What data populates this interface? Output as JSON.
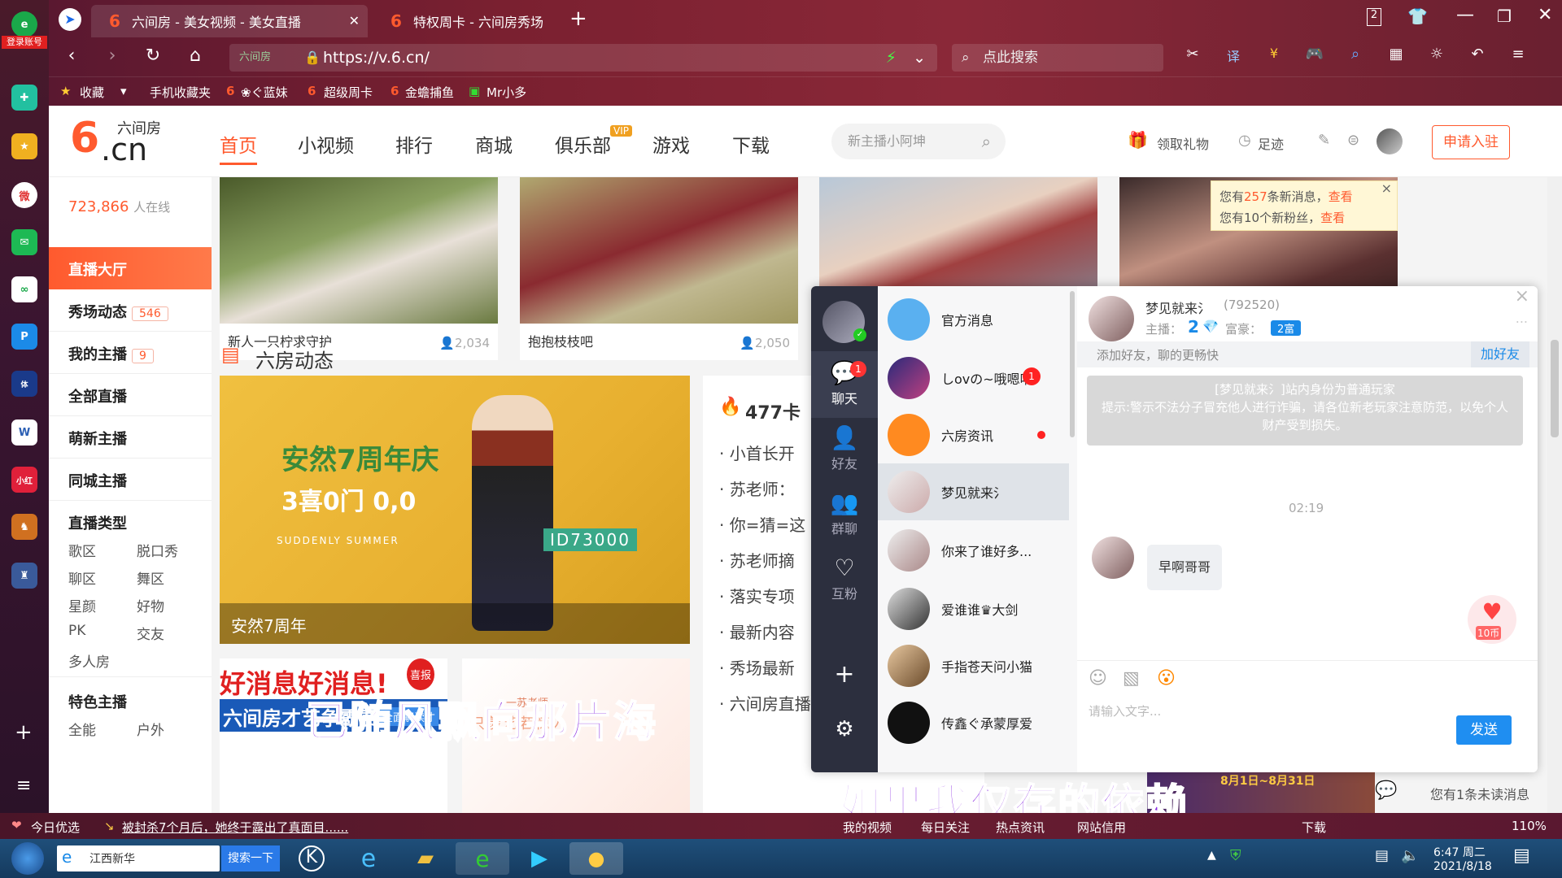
{
  "dock": {
    "login_label": "登录账号",
    "app_icons": [
      "browser-logo-icon",
      "plus-app-icon",
      "star-app-icon",
      "weibo-icon",
      "mail-icon",
      "cloud-icon",
      "p-app-icon",
      "sports-app-icon",
      "word-icon",
      "xiaohongshu-icon",
      "game-icon",
      "game2-icon"
    ],
    "add_label": "+",
    "menu_label": "≡"
  },
  "browser": {
    "tabs": [
      {
        "label": "六间房 - 美女视频 - 美女直播"
      },
      {
        "label": "特权周卡 - 六间房秀场"
      }
    ],
    "new_tab": "+",
    "url": "https://v.6.cn/",
    "url_site_tag": "六间房",
    "search_placeholder": "点此搜索",
    "bookmarks": [
      "收藏",
      "手机收藏夹",
      "❀ぐ蓝妹",
      "超级周卡",
      "金蟾捕鱼",
      "Mr小多"
    ],
    "window_count": "2"
  },
  "site": {
    "logo_text": "六间房",
    "logo_big": "6.cn",
    "nav": [
      "首页",
      "小视频",
      "排行",
      "商城",
      "俱乐部",
      "游戏",
      "下载"
    ],
    "vip_badge": "VIP",
    "search_placeholder": "新主播小阿坤",
    "gift_label": "领取礼物",
    "footprint_label": "足迹",
    "apply_label": "申请入驻"
  },
  "sidebar": {
    "online_count": "723,866",
    "online_suffix": "人在线",
    "items": [
      {
        "label": "直播大厅"
      },
      {
        "label": "秀场动态",
        "badge": "546"
      },
      {
        "label": "我的主播",
        "badge": "9"
      },
      {
        "label": "全部直播"
      },
      {
        "label": "萌新主播"
      },
      {
        "label": "同城主播"
      },
      {
        "label": "直播类型"
      }
    ],
    "types": [
      "歌区",
      "脱口秀",
      "聊区",
      "舞区",
      "星颜",
      "好物",
      "PK",
      "交友",
      "多人房"
    ],
    "special_label": "特色主播",
    "special_items": [
      "全能",
      "户外"
    ]
  },
  "cards": [
    {
      "title": "新人一只柠求守护",
      "count": "2,034"
    },
    {
      "title": "抱抱枝枝吧",
      "count": "2,050"
    }
  ],
  "notice": {
    "line1_a": "您有",
    "line1_n": "257",
    "line1_b": "条新消息，",
    "line1_link": "查看",
    "line2_a": "您有10个新粉丝，",
    "line2_link": "查看",
    "close": "×"
  },
  "dynamics": {
    "title": "六房动态",
    "banner_title": "安然7周年庆",
    "banner_sub": "3喜0门 0,0",
    "banner_en": "SUDDENLY SUMMER",
    "banner_id": "ID73000",
    "banner_caption": "安然7周年",
    "hot_count": "477",
    "hot_label": "卡",
    "news": [
      "小首长开",
      "苏老师：",
      "你=猜=这",
      "苏老师摘",
      "落实专项",
      "最新内容",
      "秀场最新",
      "六间房直播文"
    ],
    "promo1": "好消息好消息!",
    "promo1_tag": "喜报",
    "promo1_sub": "六间房才艺争霸赛",
    "promo1_btn": "全面解读才",
    "promo2": "只羡艺若惊人",
    "promo2_tag": "一苏老师一"
  },
  "chat": {
    "nav": [
      "聊天",
      "好友",
      "群聊",
      "互粉"
    ],
    "chat_badge": "1",
    "add": "+",
    "list": [
      {
        "name": "官方消息"
      },
      {
        "name": "しovの~哦嗯呐",
        "badge": "1"
      },
      {
        "name": "六房资讯"
      },
      {
        "name": "梦见就来氵"
      },
      {
        "name": "你来了谁好多..."
      },
      {
        "name": "爱谁谁♛大剑"
      },
      {
        "name": "手指苍天问小猫"
      },
      {
        "name": "传鑫ぐ承蒙厚爱"
      }
    ],
    "peer_name": "梦见就来氵",
    "peer_id": "(792520)",
    "anchor_label": "主播：",
    "anchor_level": "2",
    "rich_label": "富豪：",
    "rich_level": "2富",
    "add_friend_hint": "添加好友，聊的更畅快",
    "add_friend_btn": "加好友",
    "system_line1": "[梦见就来氵]站内身份为普通玩家",
    "system_line2": "提示:警示不法分子冒充他人进行诈骗，请各位新老玩家注意防范，以免个人财产受到损失。",
    "time": "02:19",
    "message": "早啊哥哥",
    "gift_label": "10币",
    "input_placeholder": "请输入文字...",
    "send_label": "发送",
    "close": "×",
    "more": "..."
  },
  "overlay": {
    "lyric1": "已随风飘向那片海",
    "lyric2": "如果我仅存的依赖"
  },
  "unread": "您有1条未读消息",
  "bottom_banner_date": "8月1日~8月31日",
  "statusbar": {
    "left": "今日优选",
    "news": "被封杀7个月后，她终于露出了真面目......",
    "items": [
      "我的视频",
      "每日关注",
      "热点资讯",
      "网站信用",
      "下载"
    ],
    "zoom": "110%"
  },
  "taskbar": {
    "ie_label": "江西新华",
    "search_btn": "搜索一下",
    "time": "6:47 周二",
    "date": "2021/8/18"
  },
  "colors": {
    "brand": "#ff5a2e",
    "chat_nav": "#2c2f3e",
    "send": "#1f8ef1"
  }
}
